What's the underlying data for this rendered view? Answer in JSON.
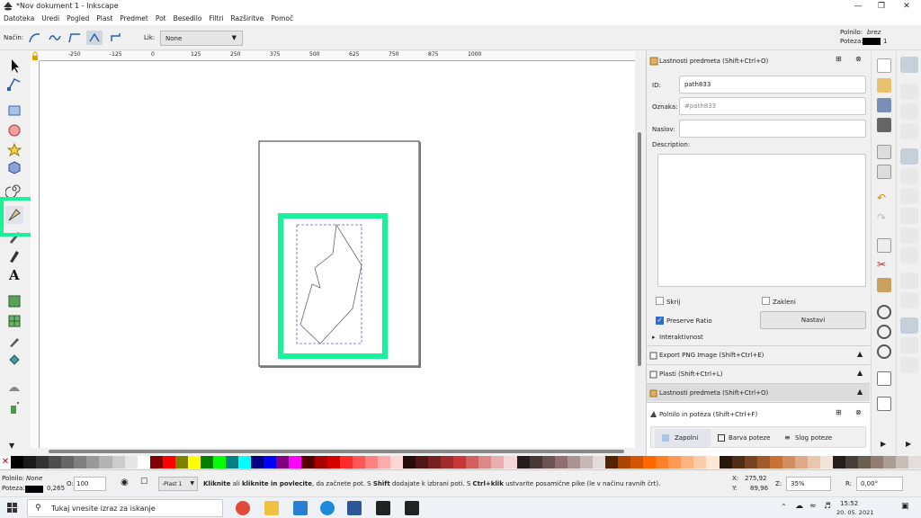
{
  "window": {
    "title": "*Nov dokument 1 - Inkscape"
  },
  "menu": [
    "Datoteka",
    "Uredi",
    "Pogled",
    "Plast",
    "Predmet",
    "Pot",
    "Besedilo",
    "Filtri",
    "Razširitve",
    "Pomoč"
  ],
  "controls": {
    "mode_label": "Način:",
    "shape_label": "Lik:",
    "shape_value": "None",
    "fill_label": "Polnilo:",
    "fill_value": "brez",
    "stroke_label": "Poteza:",
    "stroke_width": "1"
  },
  "ruler": {
    "h_ticks": [
      "-250",
      "-125",
      "0",
      "125",
      "250",
      "375",
      "500",
      "625",
      "750",
      "875",
      "1000"
    ]
  },
  "dock": {
    "object_props": {
      "title": "Lastnosti predmeta (Shift+Ctrl+O)",
      "id_label": "ID:",
      "id_value": "path833",
      "label_label": "Oznaka:",
      "label_value": "#path833",
      "title_label": "Naslov:",
      "title_value": "",
      "desc_label": "Description:",
      "hide_label": "Skrij",
      "lock_label": "Zakleni",
      "preserve_label": "Preserve Ratio",
      "set_button": "Nastavi",
      "interactivity": "Interaktivnost"
    },
    "panels": [
      "Export PNG Image (Shift+Ctrl+E)",
      "Plasti (Shift+Ctrl+L)",
      "Lastnosti predmeta (Shift+Ctrl+O)"
    ],
    "fill_stroke": {
      "title": "Polnilo in poteza (Shift+Ctrl+F)",
      "tabs": [
        "Zapolni",
        "Barva poteze",
        "Slog poteze"
      ]
    }
  },
  "palette": [
    "#000000",
    "#1a1a1a",
    "#333333",
    "#4d4d4d",
    "#666666",
    "#808080",
    "#999999",
    "#b3b3b3",
    "#cccccc",
    "#e6e6e6",
    "#ffffff",
    "#800000",
    "#ff0000",
    "#808000",
    "#ffff00",
    "#008000",
    "#00ff00",
    "#008080",
    "#00ffff",
    "#000080",
    "#0000ff",
    "#800080",
    "#ff00ff",
    "#550000",
    "#aa0000",
    "#d40000",
    "#ff2a2a",
    "#ff5555",
    "#ff8080",
    "#ffaaaa",
    "#ffd5d5",
    "#280b0b",
    "#501616",
    "#782121",
    "#a02c2c",
    "#c83737",
    "#d35f5f",
    "#de8787",
    "#e9afaf",
    "#f4d7d7",
    "#241c1c",
    "#483737",
    "#6c5353",
    "#916f6f",
    "#ac9393",
    "#c8b7b7",
    "#e3dbdb",
    "#552200",
    "#aa4400",
    "#d45500",
    "#ff6600",
    "#ff7f2a",
    "#ff9955",
    "#ffb380",
    "#ffccaa",
    "#ffe6d5",
    "#28170b",
    "#502d16",
    "#784421",
    "#a05a2c",
    "#c87137",
    "#d38d5f",
    "#deaa87",
    "#e9c6af",
    "#f4e3d7",
    "#241f1c",
    "#483e37",
    "#6c5d53",
    "#917c6f",
    "#ac9d93",
    "#c8beb7",
    "#e3dedb"
  ],
  "status": {
    "fill_label": "Polnilo:",
    "fill_value": "None",
    "stroke_label": "Poteza:",
    "stroke_width": "0,265",
    "opacity_label": "O:",
    "opacity_value": "100",
    "layer": "-Plast 1",
    "message_bold1": "Kliknite",
    "message_mid1": " ali ",
    "message_bold2": "kliknite in povlecite",
    "message_mid2": ", da začnete pot. S ",
    "message_bold3": "Shift",
    "message_mid3": " dodajate k izbrani poti. S ",
    "message_bold4": "Ctrl+klik",
    "message_tail": " ustvarite posamične pike (le v načinu ravnih črt).",
    "x_label": "X:",
    "x_value": "275,92",
    "y_label": "Y:",
    "y_value": "89,96",
    "zoom_label": "Z:",
    "zoom_value": "35%",
    "rot_label": "R:",
    "rot_value": "0,00°"
  },
  "taskbar": {
    "search_placeholder": "Tukaj vnesite izraz za iskanje",
    "time": "15:52",
    "date": "20. 05. 2021"
  },
  "highlight_color": "#1af29a"
}
